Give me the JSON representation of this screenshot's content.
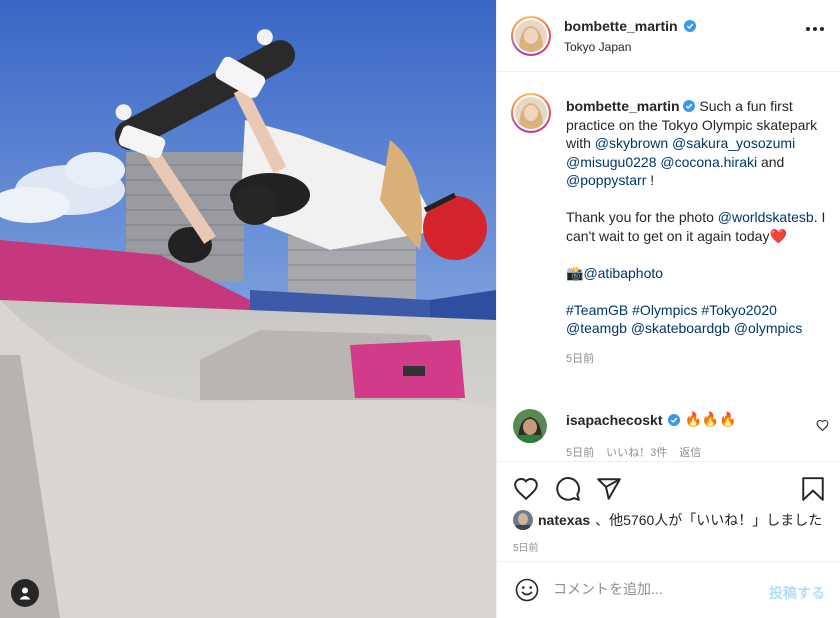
{
  "post": {
    "author": "bombette_martin",
    "location": "Tokyo Japan",
    "caption_parts": {
      "p1": "Such a fun first practice on the Tokyo Olympic skatepark with",
      "m1": "@skybrown",
      "m2": "@sakura_yosozumi",
      "m3": "@misugu0228",
      "m4": "@cocona.hiraki",
      "and": "and",
      "m5": "@poppystarr",
      "bang": "!",
      "p2": "Thank you for the photo",
      "m6": "@worldskatesb",
      "p3": ". I can't wait to get on it again today",
      "heart": "❤️",
      "camera": "📸",
      "m7": "@atibaphoto",
      "h1": "#TeamGB",
      "h2": "#Olympics",
      "h3": "#Tokyo2020",
      "m8": "@teamgb",
      "m9": "@skateboardgb",
      "m10": "@olympics"
    },
    "caption_time": "5日前"
  },
  "reply": {
    "author": "isapachecoskt",
    "text": "🔥🔥🔥",
    "time": "5日前",
    "likes": "いいね！3件",
    "reply_label": "返信"
  },
  "likes_bar": {
    "user": "natexas",
    "suffix": "、他5760人が「いいね！」しました"
  },
  "post_time": "5日前",
  "composer": {
    "placeholder": "コメントを追加...",
    "post_label": "投稿する"
  },
  "icons": {
    "more": "more-options-icon",
    "verified": "verified-badge-icon",
    "like": "heart-outline-icon",
    "comment": "comment-bubble-icon",
    "share": "paper-plane-icon",
    "save": "bookmark-icon",
    "emoji": "emoji-smile-icon",
    "tag": "user-tag-icon"
  },
  "colors": {
    "link": "#00376b",
    "verified": "#3897f0",
    "muted": "#8e8e8e",
    "post_button_disabled": "#b2dffc"
  }
}
